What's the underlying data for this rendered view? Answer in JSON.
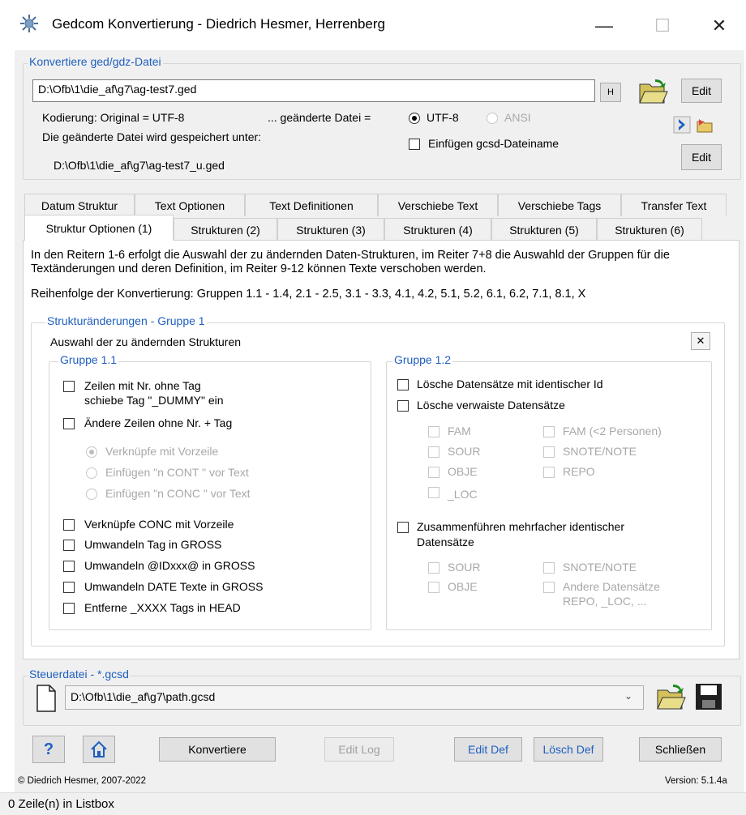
{
  "window": {
    "title": "Gedcom Konvertierung  -  Diedrich Hesmer, Herrenberg",
    "minimize_glyph": "—",
    "maximize_glyph": "☐",
    "close_glyph": "✕"
  },
  "convert_group": {
    "title": "Konvertiere ged/gdz-Datei",
    "file_path": "D:\\Ofb\\1\\die_af\\g7\\ag-test7.ged",
    "h_button": "H",
    "edit_button": "Edit",
    "encoding_label": "Kodierung:  Original = UTF-8",
    "changed_file_label": "... geänderte Datei =",
    "utf8_label": "UTF-8",
    "ansi_label": "ANSI",
    "saved_under_label": "Die geänderte Datei wird gespeichert unter:",
    "output_path": "D:\\Ofb\\1\\die_af\\g7\\ag-test7_u.ged",
    "insert_gcsd_label": "Einfügen gcsd-Dateiname",
    "edit_button_2": "Edit"
  },
  "tabs_row1": [
    "Datum Struktur",
    "Text Optionen",
    "Text Definitionen",
    "Verschiebe Text",
    "Verschiebe Tags",
    "Transfer Text"
  ],
  "tabs_row2": [
    "Struktur Optionen (1)",
    "Strukturen (2)",
    "Strukturen (3)",
    "Strukturen (4)",
    "Strukturen (5)",
    "Strukturen (6)"
  ],
  "panel": {
    "description": "In den Reitern 1-6 erfolgt die Auswahl der zu ändernden Daten-Strukturen, im Reiter 7+8 die Auswahld der Gruppen für die Textänderungen und deren Definition, im Reiter 9-12 können Texte verschoben werden.",
    "order": "Reihenfolge der Konvertierung: Gruppen 1.1 - 1.4, 2.1 - 2.5, 3.1 - 3.3, 4.1, 4.2, 5.1, 5.2, 6.1, 6.2, 7.1, 8.1, X",
    "group_title": "Strukturänderungen - Gruppe 1",
    "select_label": "Auswahl der zu ändernden Strukturen",
    "clear_glyph": "✕"
  },
  "group11": {
    "title": "Gruppe 1.1",
    "cb1_line1": "Zeilen mit Nr. ohne Tag",
    "cb1_line2": "schiebe Tag \"_DUMMY\" ein",
    "cb2": "Ändere Zeilen ohne Nr. + Tag",
    "r1": "Verknüpfe mit Vorzeile",
    "r2": "Einfügen \"n CONT \" vor Text",
    "r3": "Einfügen \"n CONC \" vor Text",
    "cb3": "Verknüpfe CONC mit Vorzeile",
    "cb4": "Umwandeln Tag in GROSS",
    "cb5": "Umwandeln @IDxxx@ in GROSS",
    "cb6": "Umwandeln DATE Texte in GROSS",
    "cb7": "Entferne _XXXX Tags in HEAD"
  },
  "group12": {
    "title": "Gruppe 1.2",
    "cb1": "Lösche Datensätze mit identischer Id",
    "cb2": "Lösche verwaiste Datensätze",
    "fam": "FAM",
    "fam2": "FAM (<2 Personen)",
    "sour": "SOUR",
    "snote": "SNOTE/NOTE",
    "obje": "OBJE",
    "repo": "REPO",
    "loc": "_LOC",
    "merge_line1": "Zusammenführen mehrfacher identischer",
    "merge_line2": "Datensätze",
    "m_sour": "SOUR",
    "m_snote": "SNOTE/NOTE",
    "m_obje": "OBJE",
    "m_other_line1": "Andere Datensätze",
    "m_other_line2": "REPO, _LOC, ..."
  },
  "control_group": {
    "title": "Steuerdatei - *.gcsd",
    "path": "D:\\Ofb\\1\\die_af\\g7\\path.gcsd"
  },
  "bottom_buttons": {
    "help": "?",
    "convert": "Konvertiere",
    "edit_log": "Edit Log",
    "edit_def": "Edit Def",
    "delete_def": "Lösch Def",
    "close": "Schließen"
  },
  "footer": {
    "copyright": "© Diedrich Hesmer,  2007-2022",
    "version": "Version: 5.1.4a",
    "status": "0 Zeile(n) in Listbox"
  },
  "colors": {
    "accent_blue": "#1f5fbf",
    "window_bg": "#f0f0f0"
  }
}
